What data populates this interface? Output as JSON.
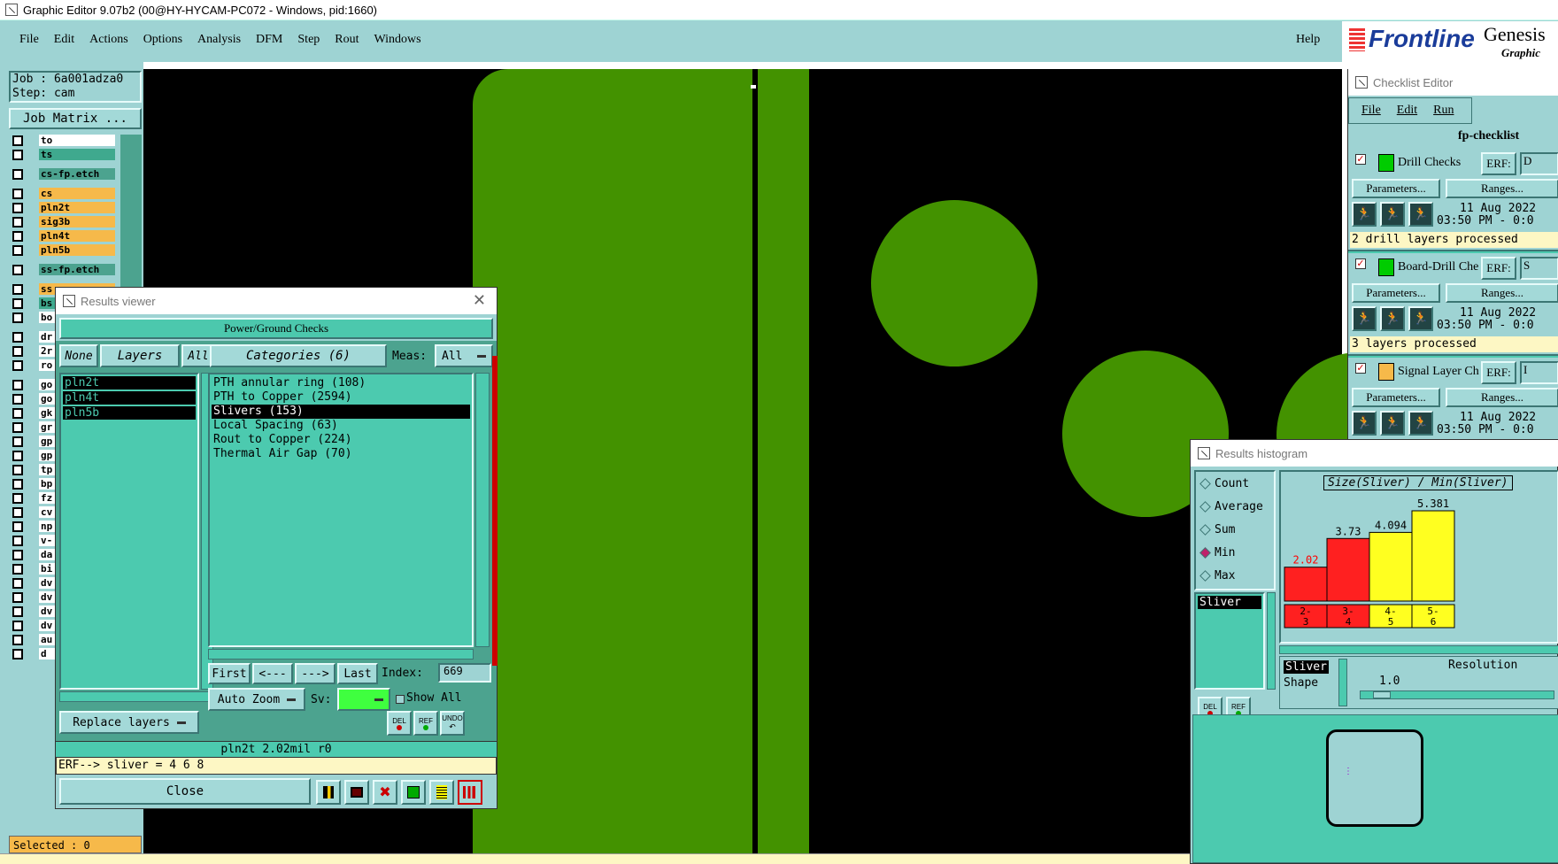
{
  "window": {
    "title": "Graphic Editor 9.07b2 (00@HY-HYCAM-PC072 - Windows, pid:1660)"
  },
  "menubar": {
    "items": [
      "File",
      "Edit",
      "Actions",
      "Options",
      "Analysis",
      "DFM",
      "Step",
      "Rout",
      "Windows"
    ],
    "help": "Help"
  },
  "brand": {
    "logo": "Frontline",
    "product": "Genesis",
    "subtitle": "Graphic"
  },
  "job_panel": {
    "job": "Job :  6a001adza0",
    "step": "Step:  cam",
    "matrix_button": "Job Matrix ...",
    "selected": "Selected : 0"
  },
  "layers": [
    {
      "name": "to",
      "color": "#ffffff"
    },
    {
      "name": "ts",
      "color": "#3fa98e"
    },
    {
      "name": "cs-fp.etch",
      "color": "#4ca38f"
    },
    {
      "name": "cs",
      "color": "#f6b94a"
    },
    {
      "name": "pln2t",
      "color": "#f6b94a"
    },
    {
      "name": "sig3b",
      "color": "#f6b94a"
    },
    {
      "name": "pln4t",
      "color": "#f6b94a"
    },
    {
      "name": "pln5b",
      "color": "#f6b94a"
    },
    {
      "name": "ss-fp.etch",
      "color": "#4ca38f"
    },
    {
      "name": "ss",
      "color": "#f6b94a"
    },
    {
      "name": "bs",
      "color": "#3fa98e"
    },
    {
      "name": "bo",
      "color": "#ffffff"
    },
    {
      "name": "dr",
      "color": "#ffffff"
    },
    {
      "name": "2r",
      "color": "#ffffff"
    },
    {
      "name": "ro",
      "color": "#ffffff"
    },
    {
      "name": "go",
      "color": "#ffffff"
    },
    {
      "name": "go",
      "color": "#ffffff"
    },
    {
      "name": "gk",
      "color": "#ffffff"
    },
    {
      "name": "gr",
      "color": "#ffffff"
    },
    {
      "name": "gp",
      "color": "#ffffff"
    },
    {
      "name": "gp",
      "color": "#ffffff"
    },
    {
      "name": "tp",
      "color": "#ffffff"
    },
    {
      "name": "bp",
      "color": "#ffffff"
    },
    {
      "name": "fz",
      "color": "#ffffff"
    },
    {
      "name": "cv",
      "color": "#ffffff"
    },
    {
      "name": "np",
      "color": "#ffffff"
    },
    {
      "name": "v-",
      "color": "#ffffff"
    },
    {
      "name": "da",
      "color": "#ffffff"
    },
    {
      "name": "bi",
      "color": "#ffffff"
    },
    {
      "name": "dv",
      "color": "#ffffff"
    },
    {
      "name": "dv",
      "color": "#ffffff"
    },
    {
      "name": "dv",
      "color": "#ffffff"
    },
    {
      "name": "dv",
      "color": "#ffffff"
    },
    {
      "name": "au",
      "color": "#ffffff"
    },
    {
      "name": "d",
      "color": "#ffffff"
    }
  ],
  "results_viewer": {
    "title": "Results viewer",
    "header": "Power/Ground Checks",
    "none_btn": "None",
    "layers_btn": "Layers",
    "all_btn": "All",
    "categories_btn": "Categories (6)",
    "meas_label": "Meas:",
    "meas_value": "All",
    "layer_list": [
      "pln2t",
      "pln4t",
      "pln5b"
    ],
    "categories": [
      "PTH annular ring (108)",
      "PTH to Copper (2594)",
      "Slivers (153)",
      "Local Spacing (63)",
      "Rout to Copper (224)",
      "Thermal Air Gap (70)"
    ],
    "selected_category": "Slivers (153)",
    "nav": {
      "first": "First",
      "prev": "<---",
      "next": "--->",
      "last": "Last",
      "index_label": "Index:",
      "index_value": "669"
    },
    "auto_zoom": "Auto Zoom",
    "sv_label": "Sv:",
    "show_all": "Show All",
    "replace_layers": "Replace layers",
    "icon_del": "DEL",
    "icon_ref": "REF",
    "icon_undo": "UNDO",
    "status": "pln2t 2.02mil  r0",
    "erf": "ERF--> sliver = 4 6 8",
    "close": "Close"
  },
  "checklist": {
    "title": "Checklist Editor",
    "menu": [
      "File",
      "Edit",
      "Run"
    ],
    "name": "fp-checklist",
    "erf_label": "ERF:",
    "params_label": "Parameters...",
    "ranges_label": "Ranges...",
    "checks": [
      {
        "name": "Drill Checks",
        "date": "11 Aug 2022",
        "time": "03:50 PM - 0:0",
        "status": "2 drill layers processed",
        "erf_val": "D"
      },
      {
        "name": "Board-Drill Che",
        "date": "11 Aug 2022",
        "time": "03:50 PM - 0:0",
        "status": "3 layers processed",
        "erf_val": "S"
      },
      {
        "name": "Signal Layer Ch",
        "date": "11 Aug 2022",
        "time": "03:50 PM - 0:0",
        "status": "",
        "erf_val": "I"
      }
    ]
  },
  "histogram": {
    "title": "Results histogram",
    "radios": [
      "Count",
      "Average",
      "Sum",
      "Min",
      "Max"
    ],
    "selected_radio": "Min",
    "list_item": "Sliver",
    "chart_title": "Size(Sliver) / Min(Sliver)",
    "shape_selected": "Sliver",
    "shape_label": "Shape",
    "resolution_label": "Resolution",
    "resolution_value": "1.0",
    "del": "DEL",
    "ref": "REF"
  },
  "chart_data": {
    "type": "bar",
    "title": "Size(Sliver) / Min(Sliver)",
    "categories": [
      "2-\n3",
      "3-\n4",
      "4-\n5",
      "5-\n6"
    ],
    "values": [
      2.02,
      3.73,
      4.094,
      5.381
    ],
    "labels": [
      "2.02",
      "3.73",
      "4.094",
      "5.381"
    ],
    "colors": [
      "#ff2020",
      "#ff2020",
      "#ffff20",
      "#ffff20"
    ],
    "label_colors": [
      "#ff0000",
      "#000000",
      "#000000",
      "#000000"
    ],
    "ylim": [
      0,
      5.381
    ]
  },
  "colors": {
    "canvas": "#000000",
    "copper": "#439200",
    "ui_teal": "#9ed3d3",
    "selected_orange": "#f6b94a"
  }
}
